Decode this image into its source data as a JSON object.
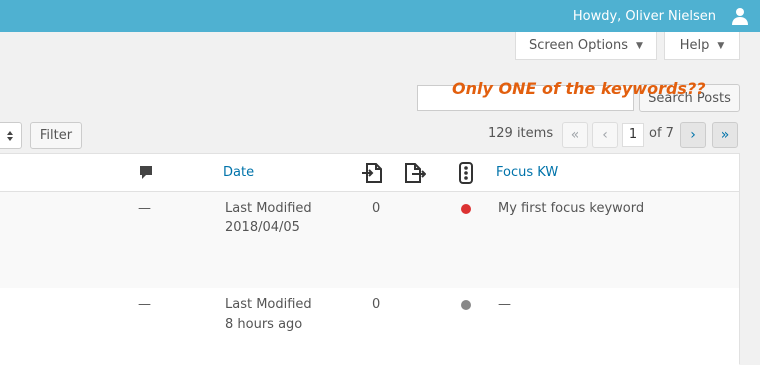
{
  "adminbar": {
    "greeting": "Howdy, Oliver Nielsen",
    "user_icon": "user-icon"
  },
  "screen_meta": {
    "screen_options_label": "Screen Options",
    "help_label": "Help"
  },
  "search": {
    "value": "",
    "button_label": "Search Posts"
  },
  "filter": {
    "bulk_select_icon": "chevron-updown-icon",
    "button_label": "Filter"
  },
  "pagination": {
    "items_count": "129 items",
    "first": "«",
    "prev": "‹",
    "current_page": "1",
    "of_total": "of 7",
    "next": "›",
    "last": "»"
  },
  "table": {
    "columns": {
      "comments_icon": "comment-icon",
      "date": "Date",
      "links_in_icon": "internal-links-in-icon",
      "links_out_icon": "internal-links-out-icon",
      "seo_score_icon": "traffic-light-icon",
      "focus_kw": "Focus KW"
    },
    "rows": [
      {
        "comments": "—",
        "date_line1": "Last Modified",
        "date_line2": "2018/04/05",
        "links": "0",
        "score_color": "#dc3232",
        "focus_kw": "My first focus keyword"
      },
      {
        "comments": "—",
        "date_line1": "Last Modified",
        "date_line2": "8 hours ago",
        "links": "0",
        "score_color": "#888888",
        "focus_kw": "—"
      }
    ]
  },
  "annotation": {
    "text": "Only ONE of the keywords??",
    "color": "#e25f0e"
  }
}
